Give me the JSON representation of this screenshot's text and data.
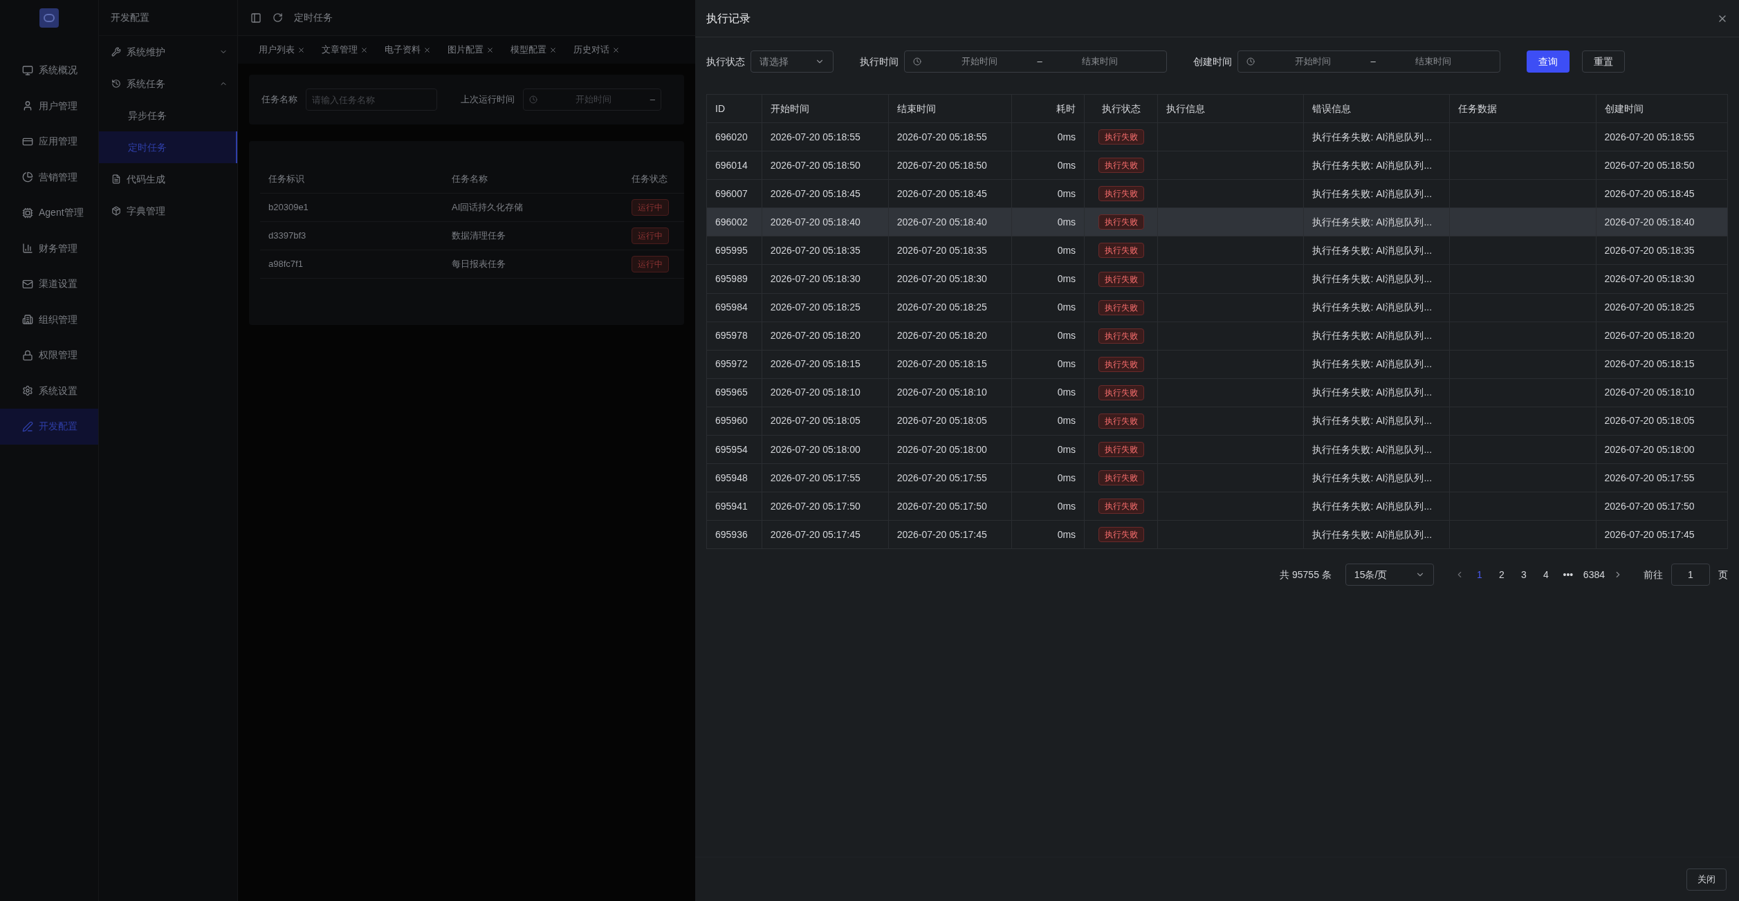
{
  "nav": [
    {
      "label": "系统概况",
      "selected": false
    },
    {
      "label": "用户管理",
      "selected": false
    },
    {
      "label": "应用管理",
      "selected": false
    },
    {
      "label": "营销管理",
      "selected": false
    },
    {
      "label": "Agent管理",
      "selected": false
    },
    {
      "label": "财务管理",
      "selected": false
    },
    {
      "label": "渠道设置",
      "selected": false
    },
    {
      "label": "组织管理",
      "selected": false
    },
    {
      "label": "权限管理",
      "selected": false
    },
    {
      "label": "系统设置",
      "selected": false
    },
    {
      "label": "开发配置",
      "selected": true
    }
  ],
  "submenu": {
    "title": "开发配置",
    "items": [
      {
        "label": "系统维护",
        "expanded": false
      },
      {
        "label": "系统任务",
        "expanded": true,
        "children": [
          {
            "label": "异步任务",
            "selected": false
          },
          {
            "label": "定时任务",
            "selected": true
          }
        ]
      },
      {
        "label": "代码生成"
      },
      {
        "label": "字典管理"
      }
    ]
  },
  "header": {
    "breadcrumb": "定时任务"
  },
  "tabs": [
    {
      "label": "用户列表"
    },
    {
      "label": "文章管理"
    },
    {
      "label": "电子资料"
    },
    {
      "label": "图片配置"
    },
    {
      "label": "模型配置"
    },
    {
      "label": "历史对话"
    }
  ],
  "filter": {
    "name_label": "任务名称",
    "name_placeholder": "请输入任务名称",
    "time_label": "上次运行时间",
    "time_start_placeholder": "开始时间",
    "separator": "–"
  },
  "task_table": {
    "columns": [
      "任务标识",
      "任务名称",
      "任务状态"
    ],
    "rows": [
      {
        "key": "b20309e1",
        "name": "AI回话持久化存储",
        "status": "运行中"
      },
      {
        "key": "d3397bf3",
        "name": "数据清理任务",
        "status": "运行中"
      },
      {
        "key": "a98fc7f1",
        "name": "每日报表任务",
        "status": "运行中"
      }
    ]
  },
  "drawer": {
    "title": "执行记录",
    "filters": {
      "status_label": "执行状态",
      "status_placeholder": "请选择",
      "exec_label": "执行时间",
      "exec_start": "开始时间",
      "exec_end": "结束时间",
      "created_label": "创建时间",
      "created_start": "开始时间",
      "created_end": "结束时间",
      "separator": "–",
      "query": "查询",
      "reset": "重置"
    },
    "columns": [
      "ID",
      "开始时间",
      "结束时间",
      "耗时",
      "执行状态",
      "执行信息",
      "错误信息",
      "任务数据",
      "创建时间"
    ],
    "rows": [
      {
        "id": "696020",
        "start": "2026-07-20 05:18:55",
        "end": "2026-07-20 05:18:55",
        "duration": "0ms",
        "status": "执行失败",
        "error": "执行任务失败: AI消息队列...",
        "created": "2026-07-20 05:18:55",
        "hovered": false
      },
      {
        "id": "696014",
        "start": "2026-07-20 05:18:50",
        "end": "2026-07-20 05:18:50",
        "duration": "0ms",
        "status": "执行失败",
        "error": "执行任务失败: AI消息队列...",
        "created": "2026-07-20 05:18:50",
        "hovered": false
      },
      {
        "id": "696007",
        "start": "2026-07-20 05:18:45",
        "end": "2026-07-20 05:18:45",
        "duration": "0ms",
        "status": "执行失败",
        "error": "执行任务失败: AI消息队列...",
        "created": "2026-07-20 05:18:45",
        "hovered": false
      },
      {
        "id": "696002",
        "start": "2026-07-20 05:18:40",
        "end": "2026-07-20 05:18:40",
        "duration": "0ms",
        "status": "执行失败",
        "error": "执行任务失败: AI消息队列...",
        "created": "2026-07-20 05:18:40",
        "hovered": true
      },
      {
        "id": "695995",
        "start": "2026-07-20 05:18:35",
        "end": "2026-07-20 05:18:35",
        "duration": "0ms",
        "status": "执行失败",
        "error": "执行任务失败: AI消息队列...",
        "created": "2026-07-20 05:18:35",
        "hovered": false
      },
      {
        "id": "695989",
        "start": "2026-07-20 05:18:30",
        "end": "2026-07-20 05:18:30",
        "duration": "0ms",
        "status": "执行失败",
        "error": "执行任务失败: AI消息队列...",
        "created": "2026-07-20 05:18:30",
        "hovered": false
      },
      {
        "id": "695984",
        "start": "2026-07-20 05:18:25",
        "end": "2026-07-20 05:18:25",
        "duration": "0ms",
        "status": "执行失败",
        "error": "执行任务失败: AI消息队列...",
        "created": "2026-07-20 05:18:25",
        "hovered": false
      },
      {
        "id": "695978",
        "start": "2026-07-20 05:18:20",
        "end": "2026-07-20 05:18:20",
        "duration": "0ms",
        "status": "执行失败",
        "error": "执行任务失败: AI消息队列...",
        "created": "2026-07-20 05:18:20",
        "hovered": false
      },
      {
        "id": "695972",
        "start": "2026-07-20 05:18:15",
        "end": "2026-07-20 05:18:15",
        "duration": "0ms",
        "status": "执行失败",
        "error": "执行任务失败: AI消息队列...",
        "created": "2026-07-20 05:18:15",
        "hovered": false
      },
      {
        "id": "695965",
        "start": "2026-07-20 05:18:10",
        "end": "2026-07-20 05:18:10",
        "duration": "0ms",
        "status": "执行失败",
        "error": "执行任务失败: AI消息队列...",
        "created": "2026-07-20 05:18:10",
        "hovered": false
      },
      {
        "id": "695960",
        "start": "2026-07-20 05:18:05",
        "end": "2026-07-20 05:18:05",
        "duration": "0ms",
        "status": "执行失败",
        "error": "执行任务失败: AI消息队列...",
        "created": "2026-07-20 05:18:05",
        "hovered": false
      },
      {
        "id": "695954",
        "start": "2026-07-20 05:18:00",
        "end": "2026-07-20 05:18:00",
        "duration": "0ms",
        "status": "执行失败",
        "error": "执行任务失败: AI消息队列...",
        "created": "2026-07-20 05:18:00",
        "hovered": false
      },
      {
        "id": "695948",
        "start": "2026-07-20 05:17:55",
        "end": "2026-07-20 05:17:55",
        "duration": "0ms",
        "status": "执行失败",
        "error": "执行任务失败: AI消息队列...",
        "created": "2026-07-20 05:17:55",
        "hovered": false
      },
      {
        "id": "695941",
        "start": "2026-07-20 05:17:50",
        "end": "2026-07-20 05:17:50",
        "duration": "0ms",
        "status": "执行失败",
        "error": "执行任务失败: AI消息队列...",
        "created": "2026-07-20 05:17:50",
        "hovered": false
      },
      {
        "id": "695936",
        "start": "2026-07-20 05:17:45",
        "end": "2026-07-20 05:17:45",
        "duration": "0ms",
        "status": "执行失败",
        "error": "执行任务失败: AI消息队列...",
        "created": "2026-07-20 05:17:45",
        "hovered": false
      }
    ],
    "pagination": {
      "total": "共 95755 条",
      "page_size": "15条/页",
      "pages": [
        {
          "label": "1",
          "selected": true
        },
        {
          "label": "2",
          "selected": false
        },
        {
          "label": "3",
          "selected": false
        },
        {
          "label": "4",
          "selected": false
        },
        {
          "label": "•••",
          "selected": false
        },
        {
          "label": "6384",
          "selected": false
        }
      ],
      "goto_label": "前往",
      "goto_value": "1",
      "goto_suffix": "页"
    },
    "close": "关闭"
  }
}
